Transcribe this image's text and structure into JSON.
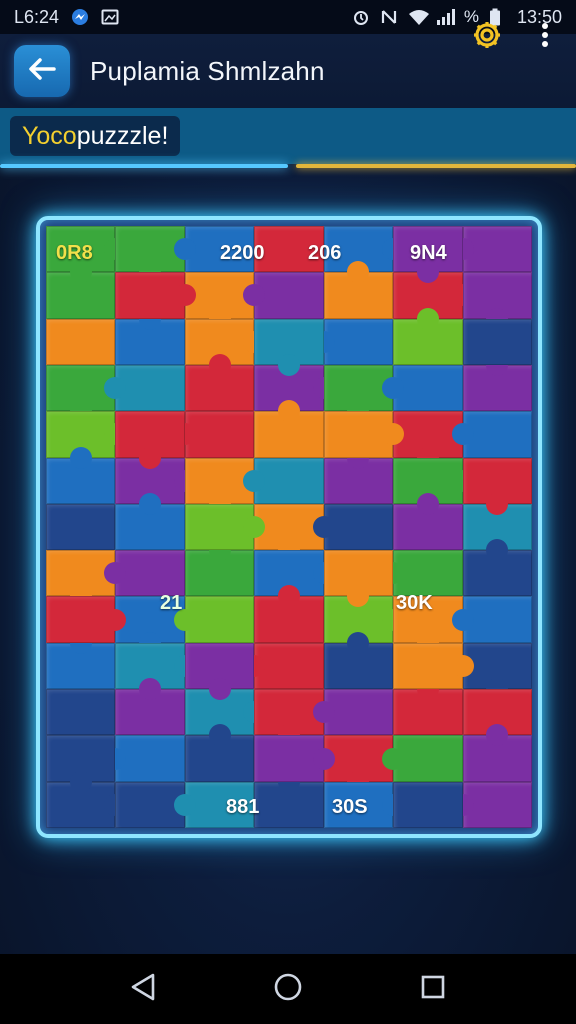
{
  "status_bar": {
    "time_left": "L6:24",
    "time_right": "13:50",
    "battery_text": "%"
  },
  "app_bar": {
    "title": "Puplamia Shmlzahn"
  },
  "subheader": {
    "label_accent": "Yoco",
    "label_rest": " puzzzle!"
  },
  "board": {
    "labels": {
      "top_left": "0R8",
      "top_2": "2200",
      "top_3": "206",
      "top_4": "9N4",
      "mid_left": "21",
      "mid_right": "30K",
      "bottom_1": "881",
      "bottom_2": "30S"
    },
    "palette": {
      "green": "#3aa83c",
      "red": "#d3283a",
      "blue": "#1f6fc0",
      "orange": "#f08a1e",
      "purple": "#7b2fa3",
      "teal": "#1f8fb0",
      "lime": "#6cbf2a",
      "navy": "#22468c"
    },
    "grid": [
      [
        "green",
        "green",
        "blue",
        "red",
        "blue",
        "purple",
        "purple"
      ],
      [
        "green",
        "red",
        "orange",
        "purple",
        "orange",
        "red",
        "purple"
      ],
      [
        "orange",
        "blue",
        "orange",
        "teal",
        "blue",
        "lime",
        "navy"
      ],
      [
        "green",
        "teal",
        "red",
        "purple",
        "green",
        "blue",
        "purple"
      ],
      [
        "lime",
        "red",
        "red",
        "orange",
        "orange",
        "red",
        "blue"
      ],
      [
        "blue",
        "purple",
        "orange",
        "teal",
        "purple",
        "green",
        "red"
      ],
      [
        "navy",
        "blue",
        "lime",
        "orange",
        "navy",
        "purple",
        "teal"
      ],
      [
        "orange",
        "purple",
        "green",
        "blue",
        "orange",
        "green",
        "navy"
      ],
      [
        "red",
        "blue",
        "lime",
        "red",
        "lime",
        "orange",
        "blue"
      ],
      [
        "blue",
        "teal",
        "purple",
        "red",
        "navy",
        "orange",
        "navy"
      ],
      [
        "navy",
        "purple",
        "teal",
        "red",
        "purple",
        "red",
        "red"
      ],
      [
        "navy",
        "blue",
        "navy",
        "purple",
        "red",
        "green",
        "purple"
      ],
      [
        "navy",
        "navy",
        "teal",
        "navy",
        "blue",
        "navy",
        "purple"
      ]
    ]
  },
  "nav_bar": {
    "back": "back",
    "home": "home",
    "recents": "recents"
  }
}
